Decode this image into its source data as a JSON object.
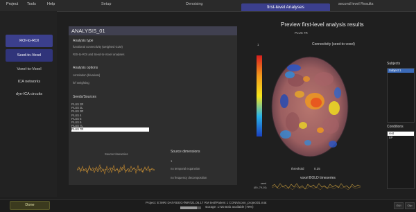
{
  "menubar": {
    "items": [
      "Project",
      "Tools",
      "Help"
    ]
  },
  "tabs": {
    "items": [
      "Setup",
      "Denoising",
      "first-level Analyses",
      "second level Results"
    ],
    "active": "first-level Analyses"
  },
  "sidebar": {
    "items": [
      "ROI-to-ROI",
      "Seed-to-Voxel",
      "Voxel-to-Voxel",
      "ICA networks",
      "dyn-ICA circuits"
    ]
  },
  "analysis": {
    "title": "ANALYSIS_01",
    "type_label": "Analysis type",
    "type_lines": [
      "functional connectivity (weighted GLM)",
      "ROI-to-ROI and Seed-to-Voxel analyses"
    ],
    "options_label": "Analysis options",
    "options_lines": [
      "correlation (bivariate)",
      "hrf weighting"
    ],
    "seeds_label": "Seeds/Sources",
    "seeds": [
      "PLUS 2R",
      "PLUS 3L",
      "PLUS 3R",
      "PLUS 4",
      "PLUS 5",
      "PLUS 6",
      "PLUS 7L",
      "PLUS 7R"
    ],
    "selected_seed": "PLUS 7R",
    "source_timeseries_label": "Source timeseries",
    "dimensions_label": "Source dimensions",
    "dimensions_value": "1",
    "expansion": "no temporal expansion",
    "decomposition": "no frequency decomposition"
  },
  "preview": {
    "title": "Preview first-level analysis results",
    "subtitle": "PLUS 7R",
    "connectivity_label": "Connectivity (seed-to-voxel)",
    "scale_max": "1",
    "threshold_label": "threshold",
    "threshold_value": "0.25",
    "bold_label": "voxel BOLD timeseries",
    "seed_legend": "seed",
    "voxel_legend": "(90,-79,10)"
  },
  "subjects": {
    "label": "Subjects",
    "items": [
      "Subject 1"
    ]
  },
  "conditions": {
    "label": "Conditions",
    "items": [
      "rest",
      "BP"
    ]
  },
  "status": {
    "done_label": "Done",
    "project": "Project: E:\\MRI DATA\\EEG-fMRI\\21.06.17 RM test\\Patient 1 CONN\\conn_project01.mat",
    "storage": "storage: 1720.5Gb available (79%)",
    "storage_fraction": 0.79,
    "btn_left": "GUI",
    "btn_right": "Clip"
  },
  "colors": {
    "accent": "#3b3f8c",
    "bg": "#1f1f1f"
  }
}
